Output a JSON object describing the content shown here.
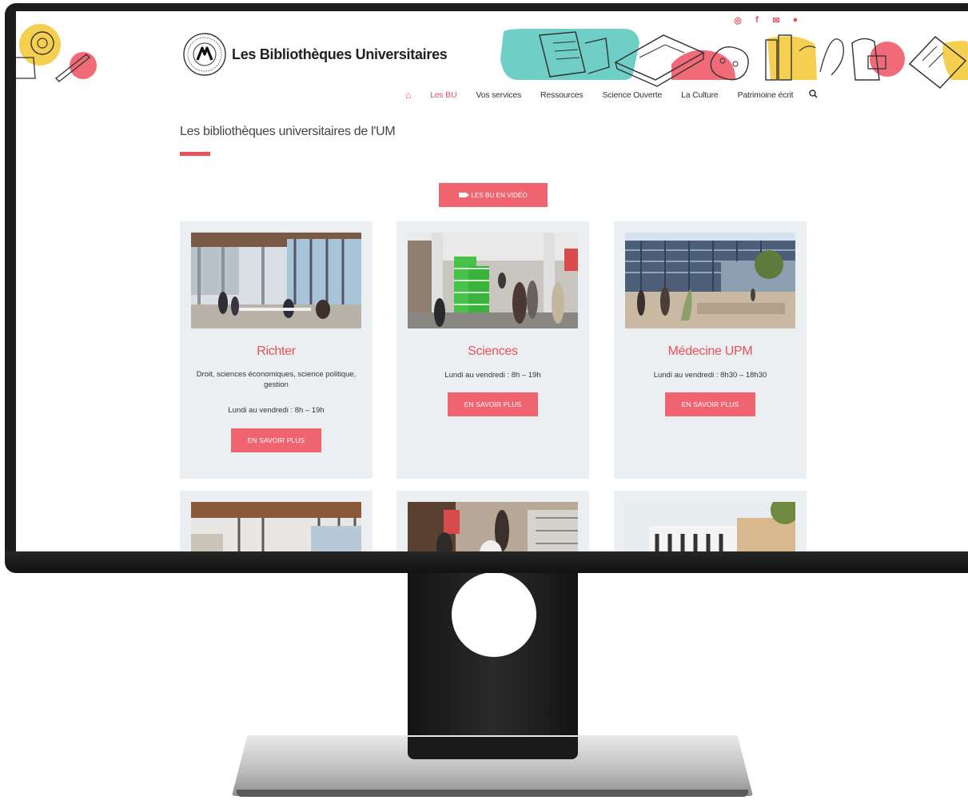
{
  "header": {
    "site_name": "Les Bibliothèques Universitaires",
    "social": [
      "instagram-icon",
      "facebook-icon",
      "mail-icon",
      "user-icon"
    ]
  },
  "nav": {
    "items": [
      {
        "label": "Les BU",
        "active": true
      },
      {
        "label": "Vos services",
        "active": false
      },
      {
        "label": "Ressources",
        "active": false
      },
      {
        "label": "Science Ouverte",
        "active": false
      },
      {
        "label": "La Culture",
        "active": false
      },
      {
        "label": "Patrimoine écrit",
        "active": false
      }
    ]
  },
  "page": {
    "title": "Les bibliothèques universitaires de l'UM",
    "video_button": "LES BU EN VIDÉO"
  },
  "cards": [
    {
      "name": "Richter",
      "desc": "Droit, sciences économiques, science politique, gestion",
      "hours": "Lundi au vendredi : 8h – 19h",
      "button": "EN SAVOIR PLUS"
    },
    {
      "name": "Sciences",
      "desc": "",
      "hours": "Lundi au vendredi : 8h – 19h",
      "button": "EN SAVOIR PLUS"
    },
    {
      "name": "Médecine UPM",
      "desc": "",
      "hours": "Lundi au vendredi : 8h30 – 18h30",
      "button": "EN SAVOIR PLUS"
    }
  ],
  "colors": {
    "accent": "#e8505b",
    "button": "#f06470",
    "card_bg": "#eceff1",
    "bezel": "#1c1c1c"
  }
}
